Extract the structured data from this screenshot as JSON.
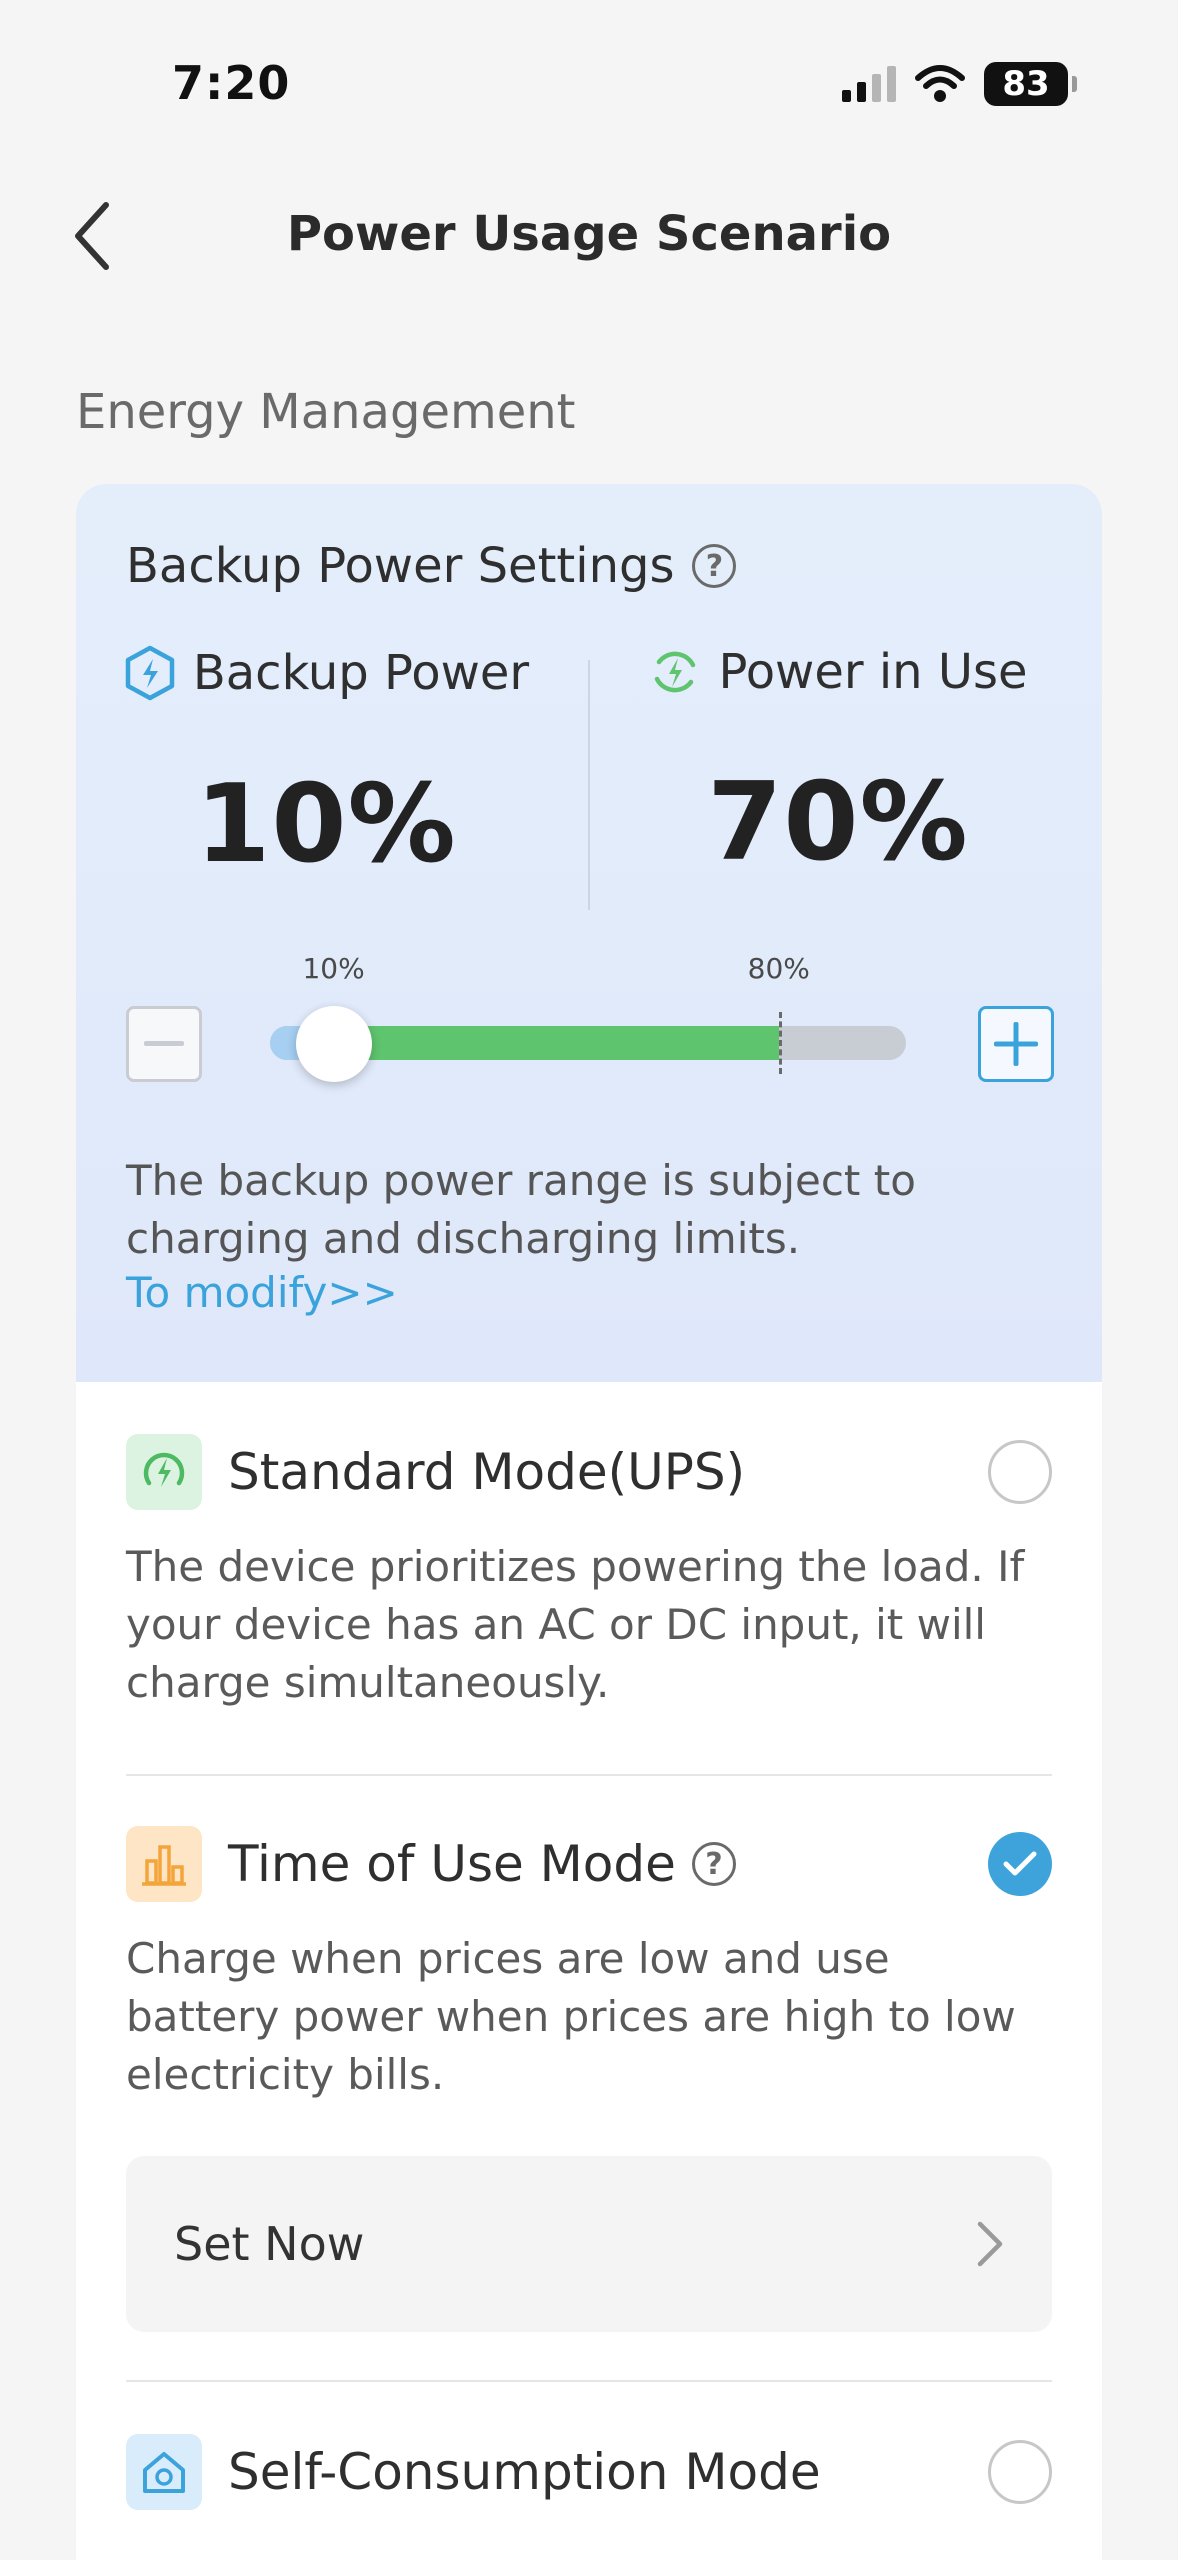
{
  "status_bar": {
    "time": "7:20",
    "battery": "83"
  },
  "header": {
    "title": "Power Usage Scenario"
  },
  "section": {
    "title": "Energy Management"
  },
  "backup_settings": {
    "title": "Backup Power Settings",
    "backup_label": "Backup Power",
    "backup_value": "10%",
    "in_use_label": "Power in Use",
    "in_use_value": "70%",
    "slider": {
      "backup_level": 10,
      "max_level": 80,
      "min_label": "10%",
      "max_label": "80%"
    },
    "note": "The backup power range is subject to charging and discharging limits.",
    "modify_link": "To modify>>"
  },
  "modes": [
    {
      "title": "Standard Mode(UPS)",
      "description": "The device prioritizes powering the load. If your device has an AC or DC input, it will charge simultaneously.",
      "selected": false,
      "icon": "lightning-cycle-icon"
    },
    {
      "title": "Time of Use Mode",
      "description": "Charge when prices are low and use battery power when prices are high to low electricity bills.",
      "selected": true,
      "icon": "bar-chart-icon",
      "action_label": "Set Now"
    },
    {
      "title": "Self-Consumption Mode",
      "selected": false,
      "icon": "home-solar-icon"
    }
  ],
  "colors": {
    "accent": "#3ba3dc",
    "in_use": "#5ec46e",
    "backup": "#a6cff2"
  }
}
